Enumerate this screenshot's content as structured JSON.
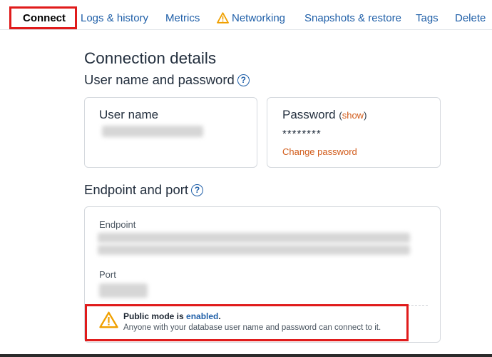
{
  "tabs": [
    {
      "label": "Connect",
      "active": true
    },
    {
      "label": "Logs & history"
    },
    {
      "label": "Metrics"
    },
    {
      "label": "Networking",
      "icon": "warning-icon"
    },
    {
      "label": "Snapshots & restore"
    },
    {
      "label": "Tags"
    },
    {
      "label": "Delete"
    }
  ],
  "main": {
    "title": "Connection details",
    "credentials_heading": "User name and password",
    "endpoint_heading": "Endpoint and port",
    "help_glyph": "?"
  },
  "user_card": {
    "label": "User name"
  },
  "password_card": {
    "label": "Password",
    "show_open": "(",
    "show_link": "show",
    "show_close": ")",
    "masked_value": "********",
    "change_link": "Change password"
  },
  "endpoint_card": {
    "endpoint_label": "Endpoint",
    "port_label": "Port"
  },
  "alert": {
    "title_prefix": "Public mode is ",
    "title_status": "enabled",
    "title_suffix": ".",
    "description": "Anyone with your database user name and password can connect to it."
  },
  "colors": {
    "link": "#1f5fa8",
    "accent_orange": "#d15b1a",
    "highlight_red": "#e01b1b",
    "warning": "#f0a000"
  }
}
